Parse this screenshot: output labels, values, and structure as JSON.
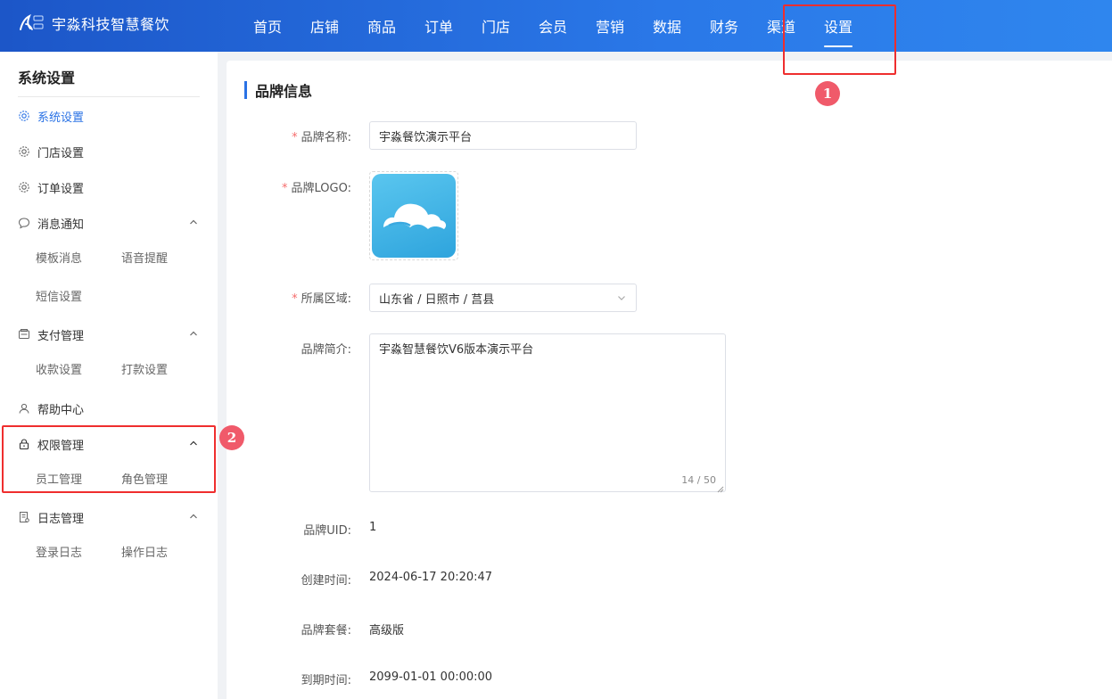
{
  "brand": {
    "title": "宇淼科技智慧餐饮"
  },
  "nav": {
    "items": [
      {
        "label": "首页"
      },
      {
        "label": "店铺"
      },
      {
        "label": "商品"
      },
      {
        "label": "订单"
      },
      {
        "label": "门店"
      },
      {
        "label": "会员"
      },
      {
        "label": "营销"
      },
      {
        "label": "数据"
      },
      {
        "label": "财务"
      },
      {
        "label": "渠道"
      },
      {
        "label": "设置",
        "active": true
      }
    ]
  },
  "sidebar": {
    "title": "系统设置",
    "items": [
      {
        "label": "系统设置",
        "icon": "gear-icon",
        "active": true
      },
      {
        "label": "门店设置",
        "icon": "gear-icon"
      },
      {
        "label": "订单设置",
        "icon": "gear-icon"
      },
      {
        "label": "消息通知",
        "icon": "chat-bubble-icon",
        "sub": [
          "模板消息",
          "语音提醒",
          "短信设置"
        ]
      },
      {
        "label": "支付管理",
        "icon": "wallet-icon",
        "sub": [
          "收款设置",
          "打款设置"
        ]
      },
      {
        "label": "帮助中心",
        "icon": "user-icon"
      },
      {
        "label": "权限管理",
        "icon": "lock-icon",
        "sub": [
          "员工管理",
          "角色管理"
        ]
      },
      {
        "label": "日志管理",
        "icon": "document-icon",
        "sub": [
          "登录日志",
          "操作日志"
        ]
      }
    ]
  },
  "form": {
    "section_title": "品牌信息",
    "brand_name": {
      "label": "品牌名称:",
      "value": "宇淼餐饮演示平台"
    },
    "brand_logo": {
      "label": "品牌LOGO:"
    },
    "region": {
      "label": "所属区域:",
      "value": "山东省 / 日照市 / 莒县"
    },
    "intro": {
      "label": "品牌简介:",
      "value": "宇淼智慧餐饮V6版本演示平台",
      "counter": "14 / 50"
    },
    "uid": {
      "label": "品牌UID:",
      "value": "1"
    },
    "created": {
      "label": "创建时间:",
      "value": "2024-06-17 20:20:47"
    },
    "package": {
      "label": "品牌套餐:",
      "value": "高级版"
    },
    "expire": {
      "label": "到期时间:",
      "value": "2099-01-01 00:00:00"
    }
  },
  "annotations": {
    "marker1": "1",
    "marker2": "2"
  },
  "colors": {
    "primary": "#2a72e5",
    "header_start": "#1c56c8",
    "header_end": "#2f86ee",
    "annotation": "#ef2e2e",
    "required": "#f56c6c"
  }
}
